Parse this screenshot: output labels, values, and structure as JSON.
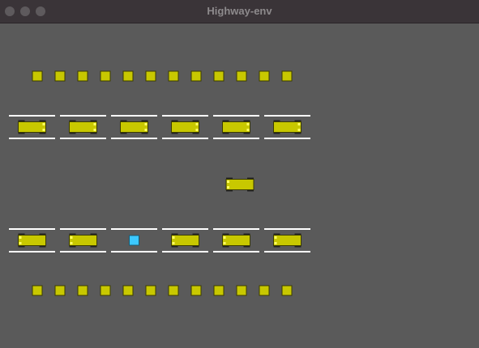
{
  "window": {
    "title": "Highway-env"
  },
  "colors": {
    "background": "#5a5a5a",
    "vehicle": "#c8c800",
    "vehicle_outline": "#3c3c00",
    "ego_vehicle": "#3cc8ff",
    "lane_line": "#ffffff",
    "headlight": "#ffff64"
  },
  "scene": {
    "top_row_obstacles": 12,
    "bottom_row_obstacles": 12,
    "top_parking_row": {
      "vehicles": [
        "car",
        "car",
        "car",
        "car",
        "car",
        "car"
      ]
    },
    "bottom_parking_row": {
      "vehicles": [
        "car",
        "car",
        "empty-goal",
        "car",
        "car",
        "car"
      ]
    },
    "moving_vehicle": "ego-car"
  }
}
